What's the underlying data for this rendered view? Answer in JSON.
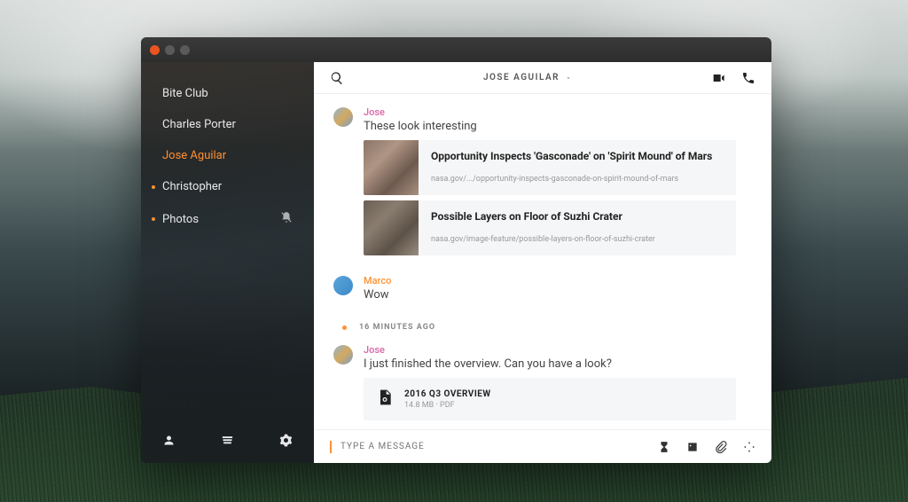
{
  "header": {
    "title": "JOSE AGUILAR"
  },
  "sidebar": {
    "items": [
      {
        "label": "Bite Club",
        "active": false,
        "dotted": false,
        "muted": false
      },
      {
        "label": "Charles Porter",
        "active": false,
        "dotted": false,
        "muted": false
      },
      {
        "label": "Jose Aguilar",
        "active": true,
        "dotted": false,
        "muted": false
      },
      {
        "label": "Christopher",
        "active": false,
        "dotted": true,
        "muted": false
      },
      {
        "label": "Photos",
        "active": false,
        "dotted": true,
        "muted": true
      }
    ]
  },
  "messages": {
    "group1": {
      "sender": "Jose",
      "text": "These look interesting",
      "link1": {
        "title": "Opportunity Inspects 'Gasconade' on 'Spirit Mound' of Mars",
        "url": "nasa.gov/.../opportunity-inspects-gasconade-on-spirit-mound-of-mars"
      },
      "link2": {
        "title": "Possible Layers on Floor of Suzhi Crater",
        "url": "nasa.gov/image-feature/possible-layers-on-floor-of-suzhi-crater"
      }
    },
    "group2": {
      "sender": "Marco",
      "text": "Wow"
    },
    "separator": "16 MINUTES AGO",
    "group3": {
      "sender": "Jose",
      "text": "I just finished the overview. Can you have a look?",
      "file": {
        "name": "2016 Q3 OVERVIEW",
        "meta": "14.8 MB · PDF"
      }
    }
  },
  "composer": {
    "placeholder": "TYPE A MESSAGE"
  }
}
